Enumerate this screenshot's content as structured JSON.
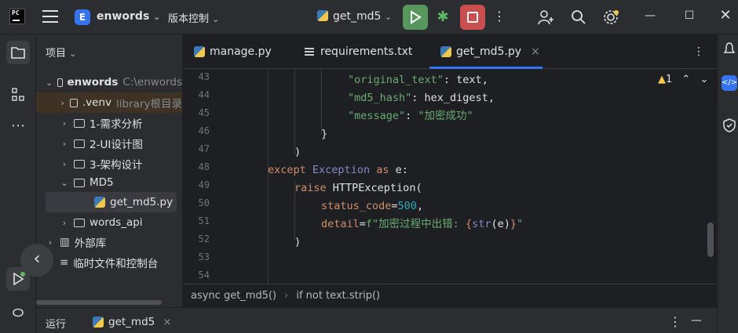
{
  "titlebar": {
    "project_badge": "E",
    "project_name": "enwords",
    "vcs_label": "版本控制",
    "run_config": "get_md5"
  },
  "project_panel": {
    "title": "项目",
    "tree": [
      {
        "label": "enwords",
        "hint": "C:\\enwords",
        "depth": 0,
        "type": "folder",
        "expanded": true
      },
      {
        "label": ".venv",
        "hint": "library根目录",
        "depth": 1,
        "type": "folder",
        "expanded": false
      },
      {
        "label": "1-需求分析",
        "depth": 1,
        "type": "folder",
        "expanded": false
      },
      {
        "label": "2-UI设计图",
        "depth": 1,
        "type": "folder",
        "expanded": false
      },
      {
        "label": "3-架构设计",
        "depth": 1,
        "type": "folder",
        "expanded": false
      },
      {
        "label": "MD5",
        "depth": 1,
        "type": "folder",
        "expanded": true
      },
      {
        "label": "get_md5.py",
        "depth": 2,
        "type": "python",
        "selected": true
      },
      {
        "label": "words_api",
        "depth": 1,
        "type": "folder",
        "expanded": false
      },
      {
        "label": "外部库",
        "depth": 0,
        "type": "library",
        "expanded": false
      },
      {
        "label": "临时文件和控制台",
        "depth": 0,
        "type": "scratch"
      }
    ]
  },
  "editor": {
    "tabs": [
      {
        "label": "manage.py",
        "icon": "python-file-icon",
        "active": false
      },
      {
        "label": "requirements.txt",
        "icon": "text-file-icon",
        "active": false
      },
      {
        "label": "get_md5.py",
        "icon": "python-file-icon",
        "active": true,
        "close": "×"
      }
    ],
    "warning_count": "1",
    "line_numbers": [
      "43",
      "44",
      "45",
      "46",
      "47",
      "48",
      "49",
      "50",
      "51",
      "52",
      "53",
      "54"
    ],
    "code": {
      "l43_key": "\"original_text\"",
      "l43_rest": ": text,",
      "l44_key": "\"md5_hash\"",
      "l44_rest": ": hex_digest,",
      "l45_key": "\"message\"",
      "l45_sep": ": ",
      "l45_val": "\"加密成功\"",
      "l46": "}",
      "l47": ")",
      "l48_kw": "except",
      "l48_cls": "Exception",
      "l48_as": "as",
      "l48_rest": "e:",
      "l49_kw": "raise",
      "l49_rest": "HTTPException(",
      "l50_param": "status_code",
      "l50_eq": "=",
      "l50_num": "500",
      "l50_comma": ",",
      "l51_param": "detail",
      "l51_eq": "=",
      "l51_fstr": "f\"加密过程中出错: ",
      "l51_open": "{",
      "l51_bi": "str",
      "l51_expr": "(e)",
      "l51_close": "}",
      "l51_end": "\"",
      "l52": ")"
    },
    "breadcrumb": [
      "async get_md5()",
      "if not text.strip()"
    ]
  },
  "bottom_panel": {
    "tab_run": "运行",
    "run_config": "get_md5"
  }
}
